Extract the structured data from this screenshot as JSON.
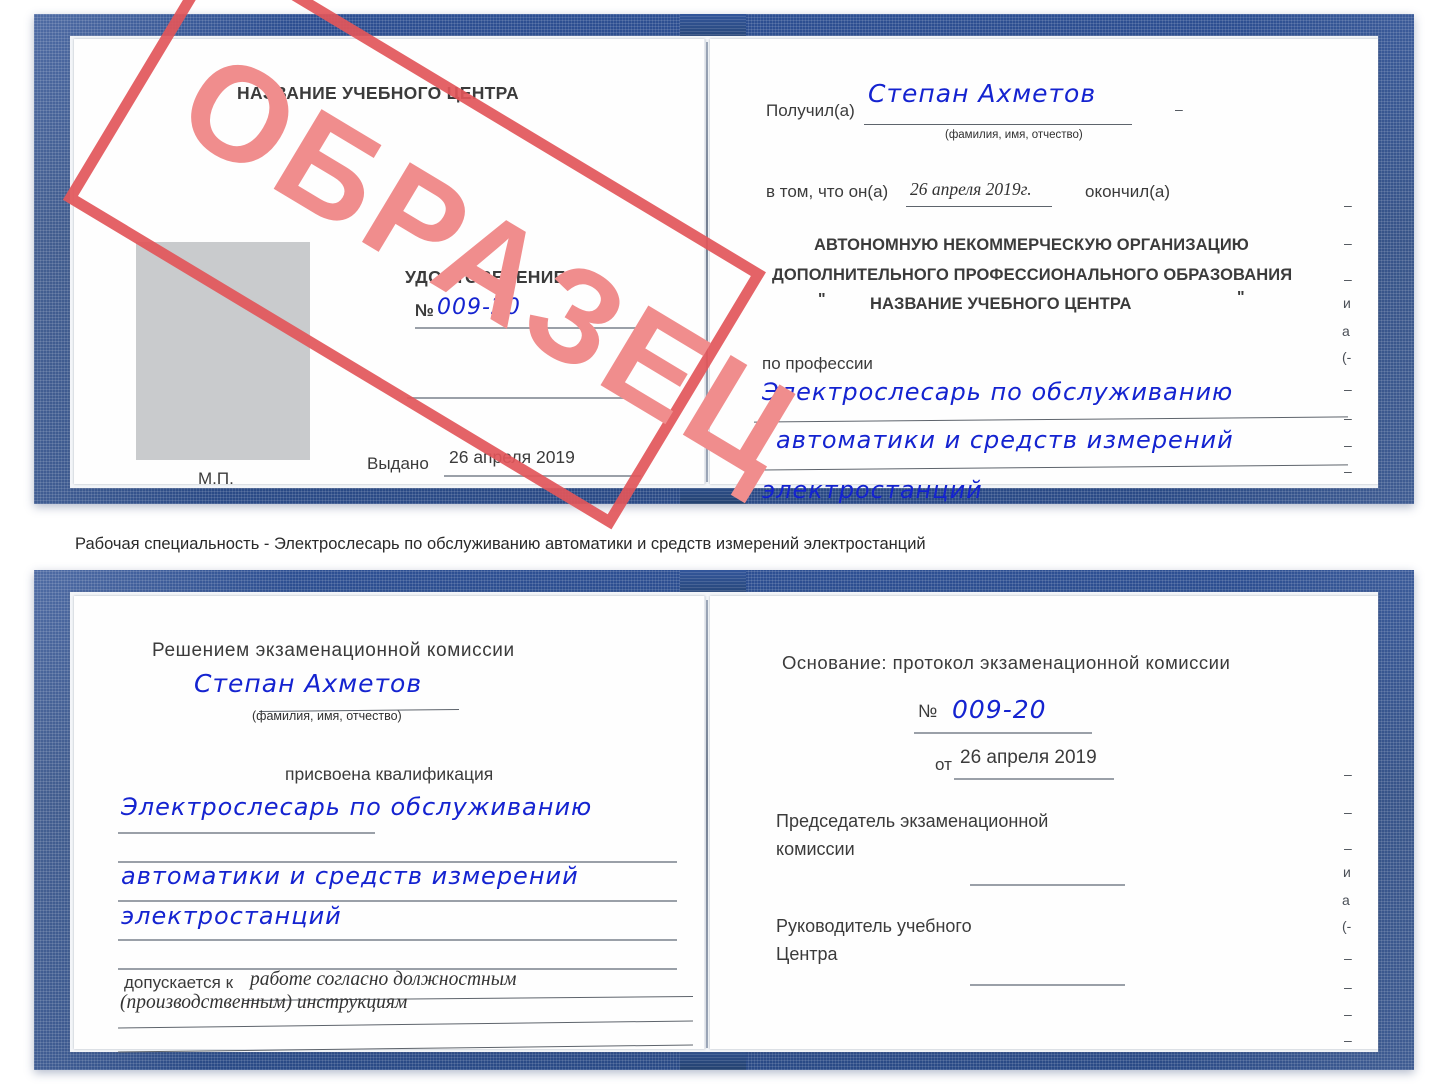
{
  "document": {
    "type": "Удостоверение",
    "watermark": "ОБРАЗЕЦ",
    "colors": {
      "cover": "#2d4f92",
      "handwriting": "#1423d0",
      "watermark_text": "#f08d8d",
      "watermark_frame": "#e2565a",
      "rule": "#9aa0a8",
      "photo_placeholder": "#c9cbcd"
    }
  },
  "certificate_top": {
    "left_page": {
      "center_name": "НАЗВАНИЕ УЧЕБНОГО ЦЕНТРА",
      "doc_title": "УДОСТОВЕРЕНИЕ",
      "number_label": "№",
      "number_value": "009-20",
      "issued_label": "Выдано",
      "issued_value": "26 апреля 2019",
      "seal_label": "М.П.",
      "photo_placeholder": "photo-placeholder"
    },
    "right_page": {
      "received_label": "Получил(а)",
      "received_value": "Степан Ахметов",
      "fio_hint": "(фамилия, имя, отчество)",
      "in_that_label": "в том, что он(а)",
      "completion_date": "26 апреля 2019г.",
      "finished_label": "окончил(а)",
      "org_line1": "АВТОНОМНУЮ НЕКОММЕРЧЕСКУЮ ОРГАНИЗАЦИЮ",
      "org_line2": "ДОПОЛНИТЕЛЬНОГО ПРОФЕССИОНАЛЬНОГО ОБРАЗОВАНИЯ",
      "org_quote_open": "\"",
      "org_line3": "НАЗВАНИЕ УЧЕБНОГО ЦЕНТРА",
      "org_quote_close": "\"",
      "profession_label": "по профессии",
      "profession_line1": "Электрослесарь по обслуживанию",
      "profession_line2": "автоматики и средств измерений",
      "profession_line3": "электростанций",
      "edge_marks": [
        "–",
        "–",
        "–",
        "и",
        "а",
        "(-",
        "–",
        "–",
        "–",
        "–"
      ]
    }
  },
  "caption": "Рабочая специальность - Электрослесарь по обслуживанию автоматики и средств измерений электростанций",
  "certificate_bottom": {
    "left_page": {
      "heading": "Решением экзаменационной комиссии",
      "name_value": "Степан Ахметов",
      "fio_hint": "(фамилия, имя, отчество)",
      "qualification_label": "присвоена квалификация",
      "qualification_line1": "Электрослесарь по обслуживанию",
      "qualification_line2": "автоматики и средств измерений",
      "qualification_line3": "электростанций",
      "admitted_label": "допускается к",
      "admitted_value_line1": "работе согласно должностным",
      "admitted_value_line2": "(производственным) инструкциям"
    },
    "right_page": {
      "basis_label": "Основание: протокол экзаменационной комиссии",
      "number_label": "№",
      "number_value": "009-20",
      "date_label": "от",
      "date_value": "26 апреля 2019",
      "chairman_line1": "Председатель экзаменационной",
      "chairman_line2": "комиссии",
      "head_line1": "Руководитель учебного",
      "head_line2": "Центра",
      "edge_marks": [
        "–",
        "–",
        "–",
        "и",
        "а",
        "(-",
        "–",
        "–",
        "–",
        "–"
      ]
    }
  }
}
